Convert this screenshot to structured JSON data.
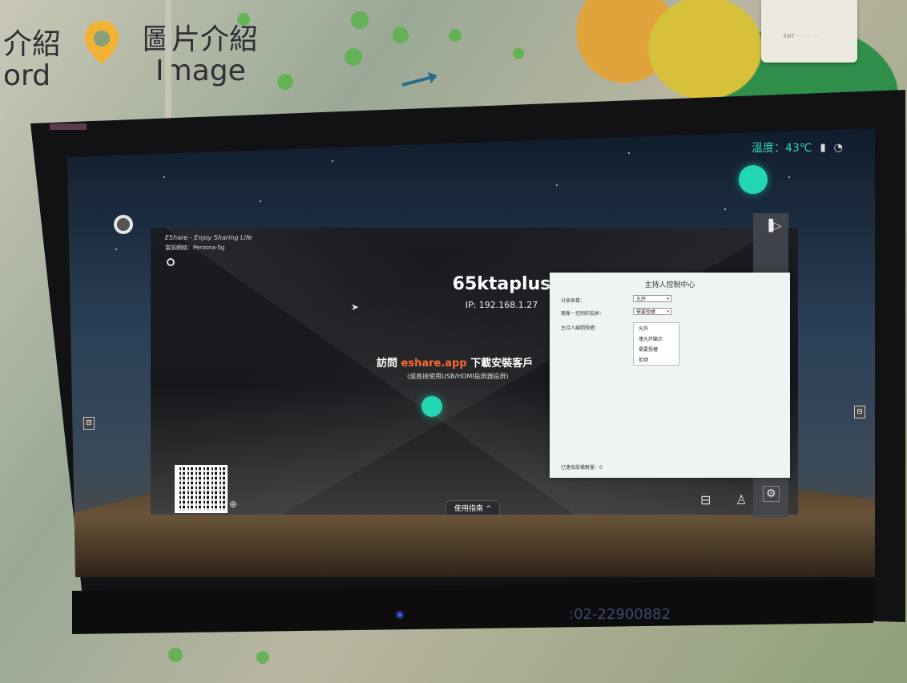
{
  "wall": {
    "text_left_top": "介紹",
    "text_left_bottom": "ord",
    "text_right_top": "圖片介紹",
    "text_right_bottom": "Image",
    "phone": ":02-22900882"
  },
  "status_bar": {
    "temperature": "溫度：43℃",
    "icons": [
      "usb-icon",
      "wifi-icon"
    ]
  },
  "app": {
    "logo": "EShare - Enjoy Sharing Life",
    "network": "當前網絡：Persona-5g",
    "device_name": "65ktaplus",
    "ip": "IP: 192.168.1.27",
    "visit_prefix": "訪問",
    "visit_site": "eshare.app",
    "visit_suffix": "下載安裝客戶",
    "hint": "(或直接使用USB/HDMI投屏器投屏)",
    "guide_label": "使用指南 ^"
  },
  "host_panel": {
    "title": "主持人控制中心",
    "rows": [
      {
        "label": "分享屏幕：",
        "value": "允許"
      },
      {
        "label": "鏡像・控制和投屏：",
        "value": "需要授權"
      },
      {
        "label": "主持人離開授權：",
        "value": ""
      }
    ],
    "dropdown_options": [
      "允許",
      "僅允許顯示",
      "需要授權",
      "拒絕"
    ],
    "connected_label": "已連接設備數量：0"
  },
  "colors": {
    "accent_teal": "#23d6b4",
    "link_orange": "#ff6a2a"
  }
}
